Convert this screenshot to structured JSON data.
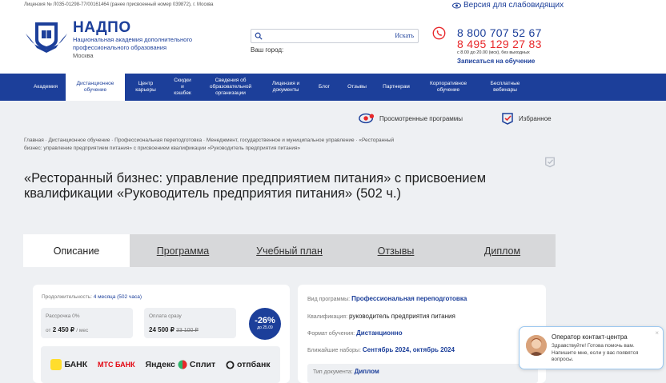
{
  "header": {
    "license": "Лицензия № Л035-01298-77/00161464 (ранее присвоенный номер 039872), г. Москва",
    "accessibility": "Версия для слабовидящих",
    "brand": "НАДПО",
    "brand_sub": "Национальная академия дополнительного профессионального образования",
    "city_label": "Москва",
    "search": {
      "placeholder": "",
      "button": "Искать"
    },
    "your_city": "Ваш город:",
    "phone1": "8 800 707 52 67",
    "phone2": "8 495 129 27 83",
    "hours": "с 8.00 до 20.00 (мск), без выходных",
    "signup": "Записаться на обучение"
  },
  "nav": [
    {
      "label": "Академия"
    },
    {
      "label": "Дистанционное обучение",
      "active": true
    },
    {
      "label": "Центр карьеры"
    },
    {
      "label": "Скидки и кэшбек"
    },
    {
      "label": "Сведения об образовательной организации"
    },
    {
      "label": "Лицензия и документы"
    },
    {
      "label": "Блог"
    },
    {
      "label": "Отзывы"
    },
    {
      "label": "Партнерам"
    },
    {
      "label": "Корпоративное обучение"
    },
    {
      "label": "Бесплатные вебинары"
    }
  ],
  "tools": {
    "viewed": "Просмотренные программы",
    "favorites": "Избранное"
  },
  "breadcrumbs": "Главная  ·  Дистанционное обучение  ·  Профессиональная переподготовка  ·  Менеджмент, государственное и муниципальное управление  ·  «Ресторанный бизнес: управление предприятием питания» с присвоением квалификации «Руководитель предприятия питания»",
  "title": "«Ресторанный бизнес: управление предприятием питания» с присвоением квалификации «Руководитель предприятия питания» (502 ч.)",
  "tabs": [
    {
      "label": "Описание",
      "active": true
    },
    {
      "label": "Программа"
    },
    {
      "label": "Учебный план"
    },
    {
      "label": "Отзывы"
    },
    {
      "label": "Диплом"
    }
  ],
  "pricing": {
    "duration_label": "Продолжительность:",
    "duration_value": "4 месяца (502 часа)",
    "installment_label": "Рассрочка 0%",
    "installment_prefix": "от",
    "installment_value": "2 450 ₽",
    "installment_suffix": "/ мес",
    "full_label": "Оплата сразу",
    "full_value": "24 500 ₽",
    "full_old": "33 100 ₽",
    "discount": "-26%",
    "discount_until": "до 25.09",
    "banks": [
      "БАНК",
      "МТС БАНК",
      "Яндекс",
      "Сплит",
      "отпбанк"
    ]
  },
  "details": {
    "type_label": "Вид программы:",
    "type_value": "Профессиональная переподготовка",
    "qual_label": "Квалификация:",
    "qual_value": "руководитель предприятия питания",
    "format_label": "Формат обучения:",
    "format_value": "Дистанционно",
    "next_label": "Ближайшие наборы:",
    "next_value": "Сентябрь 2024, октябрь 2024",
    "doc_label": "Тип документа:",
    "doc_value": "Диплом"
  },
  "chat": {
    "name": "Оператор контакт-центра",
    "message": "Здравствуйте! Готова помочь вам. Напишите мне, если у вас появятся вопросы.",
    "close": "×"
  },
  "colors": {
    "brand": "#1c3f9a",
    "accent": "#e8282b"
  }
}
